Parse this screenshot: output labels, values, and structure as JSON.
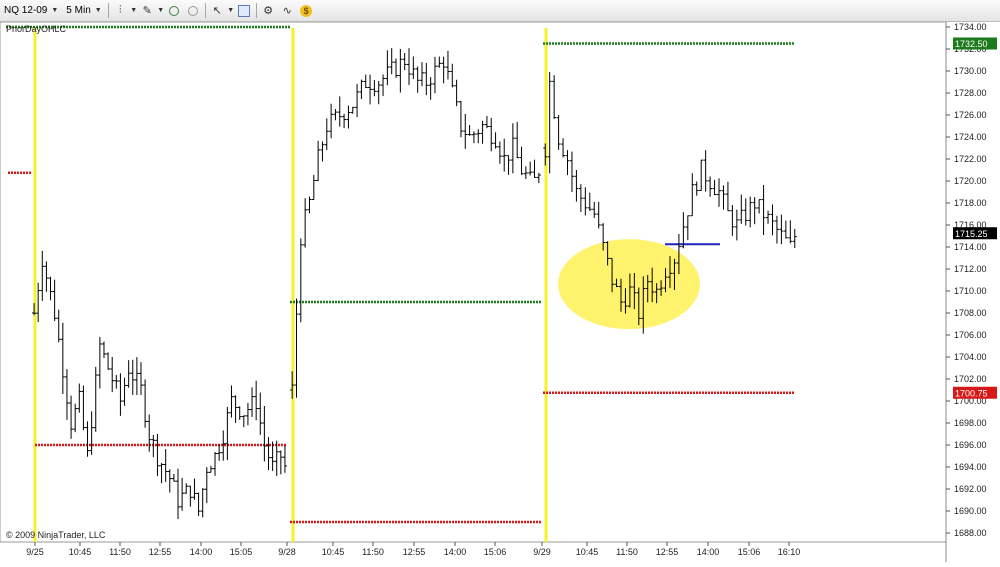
{
  "toolbar": {
    "instrument": "NQ 12-09",
    "interval": "5 Min"
  },
  "chart_data": {
    "type": "candlestick",
    "indicator_label": "PriorDayOHLC",
    "copyright": "© 2009 NinjaTrader, LLC",
    "ylim": [
      1687,
      1735
    ],
    "y_ticks": [
      "1734.00",
      "1732.00",
      "1730.00",
      "1728.00",
      "1726.00",
      "1724.00",
      "1722.00",
      "1720.00",
      "1718.00",
      "1716.00",
      "1714.00",
      "1712.00",
      "1710.00",
      "1708.00",
      "1706.00",
      "1704.00",
      "1702.00",
      "1700.00",
      "1698.00",
      "1696.00",
      "1694.00",
      "1692.00",
      "1690.00",
      "1688.00"
    ],
    "x_ticks": [
      "9/25",
      "10:45",
      "11:50",
      "12:55",
      "14:00",
      "15:05",
      "9/28",
      "10:45",
      "11:50",
      "12:55",
      "14:00",
      "15:06",
      "9/29",
      "10:45",
      "11:50",
      "12:55",
      "14:00",
      "15:06",
      "16:10"
    ],
    "price_badges": [
      {
        "label": "1732.50",
        "value": 1732.5,
        "color": "#1d7a1d"
      },
      {
        "label": "1715.25",
        "value": 1715.25,
        "color": "#000000"
      },
      {
        "label": "1700.75",
        "value": 1700.75,
        "color": "#d81818"
      }
    ],
    "session_dividers": [
      "9/25",
      "9/28",
      "9/29"
    ],
    "prior_day_levels": [
      {
        "session": "9/25",
        "high": null,
        "low": 1696.0,
        "close": null,
        "prior_close_stub": 1720.75
      },
      {
        "session": "9/28",
        "high": 1733.75,
        "low": 1689.0,
        "close": 1709.0
      },
      {
        "session": "9/29",
        "high": 1732.5,
        "low": 1700.75,
        "close": null
      }
    ],
    "annotation": {
      "type": "ellipse",
      "color": "#fff266",
      "around": [
        1706.75,
        1714.5
      ]
    },
    "reference_line": {
      "value": 1714.25,
      "color": "#1f24c0"
    },
    "bar_color": "#000000",
    "sessions": [
      {
        "name": "9/25",
        "path": [
          [
            0,
            1708
          ],
          [
            2,
            1713
          ],
          [
            5,
            1708
          ],
          [
            7,
            1703
          ],
          [
            9,
            1698
          ],
          [
            11,
            1700
          ],
          [
            13,
            1695
          ],
          [
            16,
            1705
          ],
          [
            18,
            1703
          ],
          [
            21,
            1700
          ],
          [
            23,
            1703
          ],
          [
            26,
            1701
          ],
          [
            28,
            1697
          ],
          [
            30,
            1695
          ],
          [
            33,
            1693
          ],
          [
            35,
            1691
          ],
          [
            38,
            1692
          ],
          [
            40,
            1690
          ],
          [
            42,
            1694
          ],
          [
            44,
            1695
          ],
          [
            46,
            1697
          ],
          [
            48,
            1700
          ],
          [
            51,
            1699
          ],
          [
            54,
            1700
          ],
          [
            56,
            1696
          ],
          [
            58,
            1694
          ],
          [
            60,
            1695
          ],
          [
            61,
            1694
          ]
        ]
      },
      {
        "name": "9/28",
        "path": [
          [
            0,
            1701
          ],
          [
            2,
            1715
          ],
          [
            4,
            1718
          ],
          [
            6,
            1722
          ],
          [
            8,
            1725
          ],
          [
            11,
            1726
          ],
          [
            14,
            1727
          ],
          [
            17,
            1729
          ],
          [
            20,
            1729
          ],
          [
            23,
            1730
          ],
          [
            26,
            1731
          ],
          [
            29,
            1729
          ],
          [
            31,
            1729
          ],
          [
            33,
            1730
          ],
          [
            35,
            1731
          ],
          [
            37,
            1728
          ],
          [
            39,
            1725
          ],
          [
            41,
            1724
          ],
          [
            44,
            1725
          ],
          [
            47,
            1724
          ],
          [
            49,
            1722
          ],
          [
            51,
            1723
          ],
          [
            53,
            1721
          ],
          [
            55,
            1720
          ],
          [
            56,
            1720
          ],
          [
            57,
            1721
          ]
        ]
      },
      {
        "name": "9/29",
        "path": [
          [
            0,
            1723
          ],
          [
            1,
            1729
          ],
          [
            3,
            1724
          ],
          [
            5,
            1722
          ],
          [
            7,
            1719
          ],
          [
            9,
            1718
          ],
          [
            11,
            1717
          ],
          [
            13,
            1714
          ],
          [
            15,
            1711
          ],
          [
            17,
            1709
          ],
          [
            19,
            1710
          ],
          [
            21,
            1708
          ],
          [
            23,
            1711
          ],
          [
            25,
            1710
          ],
          [
            27,
            1712
          ],
          [
            29,
            1713
          ],
          [
            31,
            1716
          ],
          [
            33,
            1719
          ],
          [
            35,
            1721
          ],
          [
            37,
            1720
          ],
          [
            39,
            1719
          ],
          [
            41,
            1717
          ],
          [
            43,
            1716
          ],
          [
            45,
            1717
          ],
          [
            47,
            1718
          ],
          [
            49,
            1717
          ],
          [
            51,
            1716
          ],
          [
            53,
            1715
          ],
          [
            55,
            1714
          ],
          [
            56,
            1715
          ]
        ]
      }
    ]
  }
}
